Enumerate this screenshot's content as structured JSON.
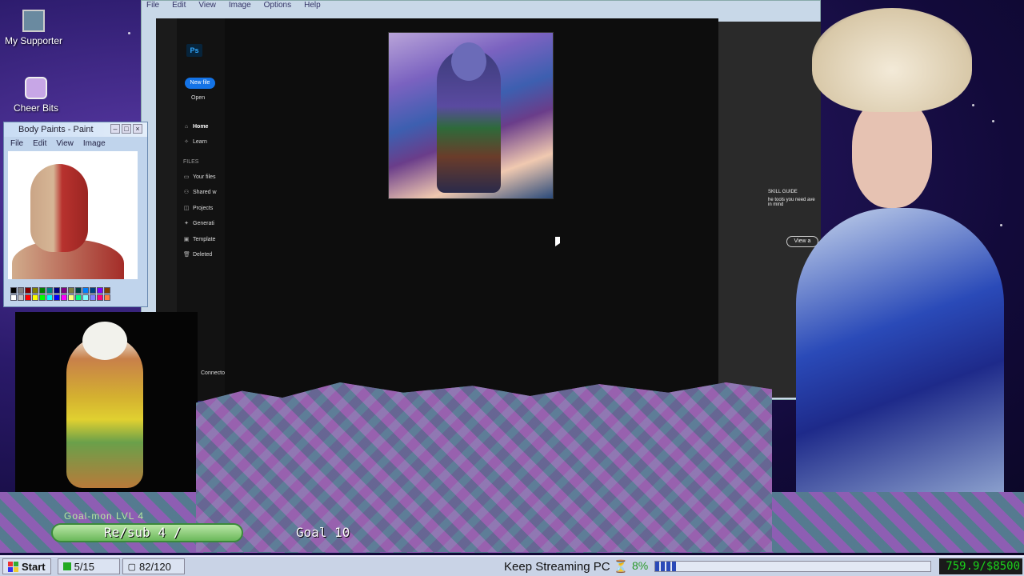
{
  "desktop": {
    "icons": [
      {
        "label": "My Supporter",
        "icon": "portrait-icon"
      },
      {
        "label": "Cheer Bits",
        "icon": "balloon-dog-icon"
      }
    ]
  },
  "main_window": {
    "menu": [
      "File",
      "Edit",
      "View",
      "Image",
      "Options",
      "Help"
    ]
  },
  "photoshop": {
    "logo": "Ps",
    "new_file": "New file",
    "open": "Open",
    "nav": [
      {
        "label": "Home",
        "icon": "home-icon"
      },
      {
        "label": "Learn",
        "icon": "lightbulb-icon"
      }
    ],
    "files_header": "FILES",
    "files": [
      {
        "label": "Your files",
        "icon": "folder-icon"
      },
      {
        "label": "Shared w",
        "icon": "share-icon"
      },
      {
        "label": "Projects",
        "icon": "projects-icon"
      },
      {
        "label": "Generati",
        "icon": "sparkle-icon"
      },
      {
        "label": "Template",
        "icon": "template-icon"
      },
      {
        "label": "Deleted",
        "icon": "trash-icon"
      }
    ],
    "connect": "Connecto",
    "skill_guide": "SKILL GUIDE",
    "skill_text": "he tools you need ave in mind",
    "view_all": "View a"
  },
  "paint": {
    "title": "Body Paints - Paint",
    "menu": [
      "File",
      "Edit",
      "View",
      "Image"
    ],
    "palette": [
      "#000000",
      "#808080",
      "#800000",
      "#808000",
      "#008000",
      "#008080",
      "#000080",
      "#800080",
      "#808040",
      "#004040",
      "#0080ff",
      "#004080",
      "#8000ff",
      "#804000",
      "#ffffff",
      "#c0c0c0",
      "#ff0000",
      "#ffff00",
      "#00ff00",
      "#00ffff",
      "#0000ff",
      "#ff00ff",
      "#ffff80",
      "#00ff80",
      "#80ffff",
      "#8080ff",
      "#ff0080",
      "#ff8040"
    ]
  },
  "goal": {
    "level": "Goal-mon LVL 4",
    "label": "Re/sub 4 /",
    "target": "Goal 10"
  },
  "taskbar": {
    "start": "Start",
    "counter1": "5/15",
    "counter2": "82/120",
    "keep_streaming": "Keep Streaming PC",
    "hourglass": "⏳",
    "percent": "8%",
    "progress": 0.08,
    "money": "759.9/$8500"
  },
  "colors": {
    "taskbar_bg": "#c9d3e6",
    "accent_blue": "#1473e6",
    "money_green": "#1bd41b"
  }
}
